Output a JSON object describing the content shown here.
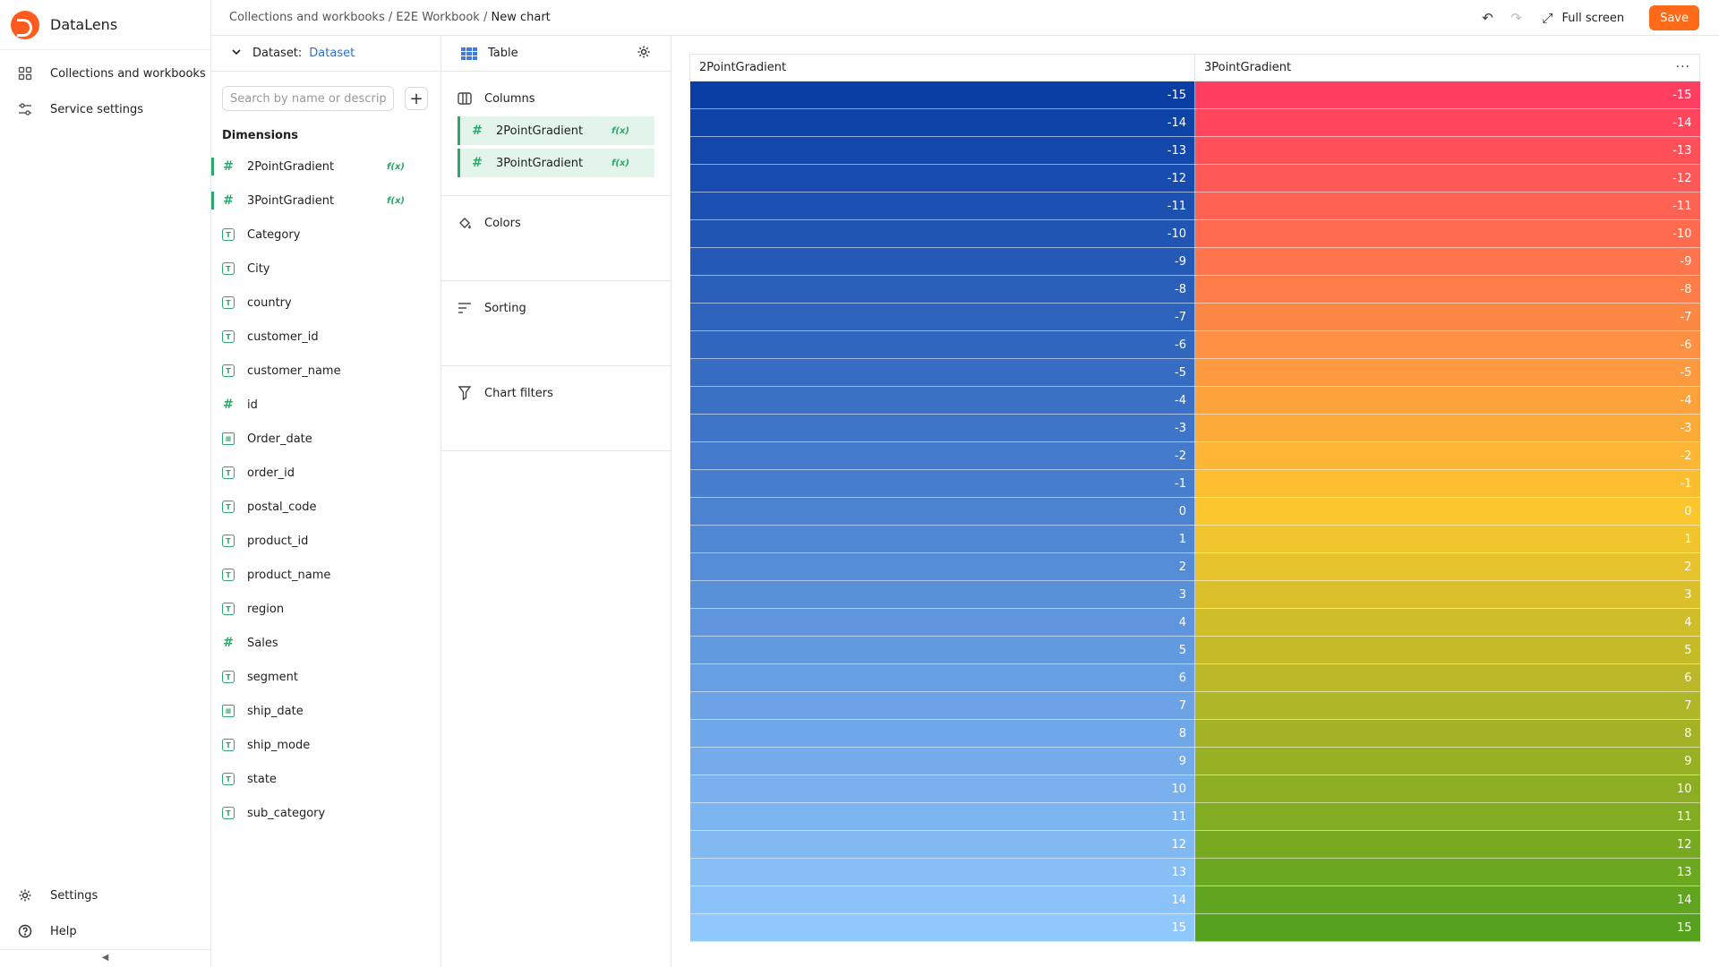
{
  "app": {
    "name": "DataLens"
  },
  "nav": {
    "items": [
      {
        "label": "Collections and workbooks",
        "icon": "grid-icon"
      },
      {
        "label": "Service settings",
        "icon": "sliders-icon"
      }
    ],
    "bottom": [
      {
        "label": "Settings",
        "icon": "gear-icon"
      },
      {
        "label": "Help",
        "icon": "help-icon"
      }
    ]
  },
  "breadcrumbs": {
    "items": [
      "Collections and workbooks",
      "E2E Workbook"
    ],
    "separator": "/",
    "current": "New chart"
  },
  "toolbar": {
    "fullscreen_label": "Full screen",
    "save_label": "Save"
  },
  "dataset": {
    "label": "Dataset:",
    "name": "Dataset",
    "search_placeholder": "Search by name or description",
    "dimensions_title": "Dimensions",
    "fields": [
      {
        "name": "2PointGradient",
        "type": "number",
        "formula": true
      },
      {
        "name": "3PointGradient",
        "type": "number",
        "formula": true
      },
      {
        "name": "Category",
        "type": "string"
      },
      {
        "name": "City",
        "type": "string"
      },
      {
        "name": "country",
        "type": "string"
      },
      {
        "name": "customer_id",
        "type": "string"
      },
      {
        "name": "customer_name",
        "type": "string"
      },
      {
        "name": "id",
        "type": "number"
      },
      {
        "name": "Order_date",
        "type": "date"
      },
      {
        "name": "order_id",
        "type": "string"
      },
      {
        "name": "postal_code",
        "type": "string"
      },
      {
        "name": "product_id",
        "type": "string"
      },
      {
        "name": "product_name",
        "type": "string"
      },
      {
        "name": "region",
        "type": "string"
      },
      {
        "name": "Sales",
        "type": "number"
      },
      {
        "name": "segment",
        "type": "string"
      },
      {
        "name": "ship_date",
        "type": "date"
      },
      {
        "name": "ship_mode",
        "type": "string"
      },
      {
        "name": "state",
        "type": "string"
      },
      {
        "name": "sub_category",
        "type": "string"
      }
    ],
    "fx_label": "f(x)"
  },
  "wizard": {
    "visualization": "Table",
    "sections": {
      "columns": {
        "title": "Columns",
        "items": [
          "2PointGradient",
          "3PointGradient"
        ]
      },
      "colors": {
        "title": "Colors"
      },
      "sorting": {
        "title": "Sorting"
      },
      "filters": {
        "title": "Chart filters"
      }
    }
  },
  "table": {
    "headers": [
      "2PointGradient",
      "3PointGradient"
    ],
    "rows": [
      -15,
      -14,
      -13,
      -12,
      -11,
      -10,
      -9,
      -8,
      -7,
      -6,
      -5,
      -4,
      -3,
      -2,
      -1,
      0,
      1,
      2,
      3,
      4,
      5,
      6,
      7,
      8,
      9,
      10,
      11,
      12,
      13,
      14,
      15
    ],
    "colors": {
      "col1_start": "#0a3ea5",
      "col1_end": "#8ec8fc",
      "col2_start": "#ff3d60",
      "col2_mid": "#fcc72e",
      "col2_end": "#56a21e"
    }
  }
}
